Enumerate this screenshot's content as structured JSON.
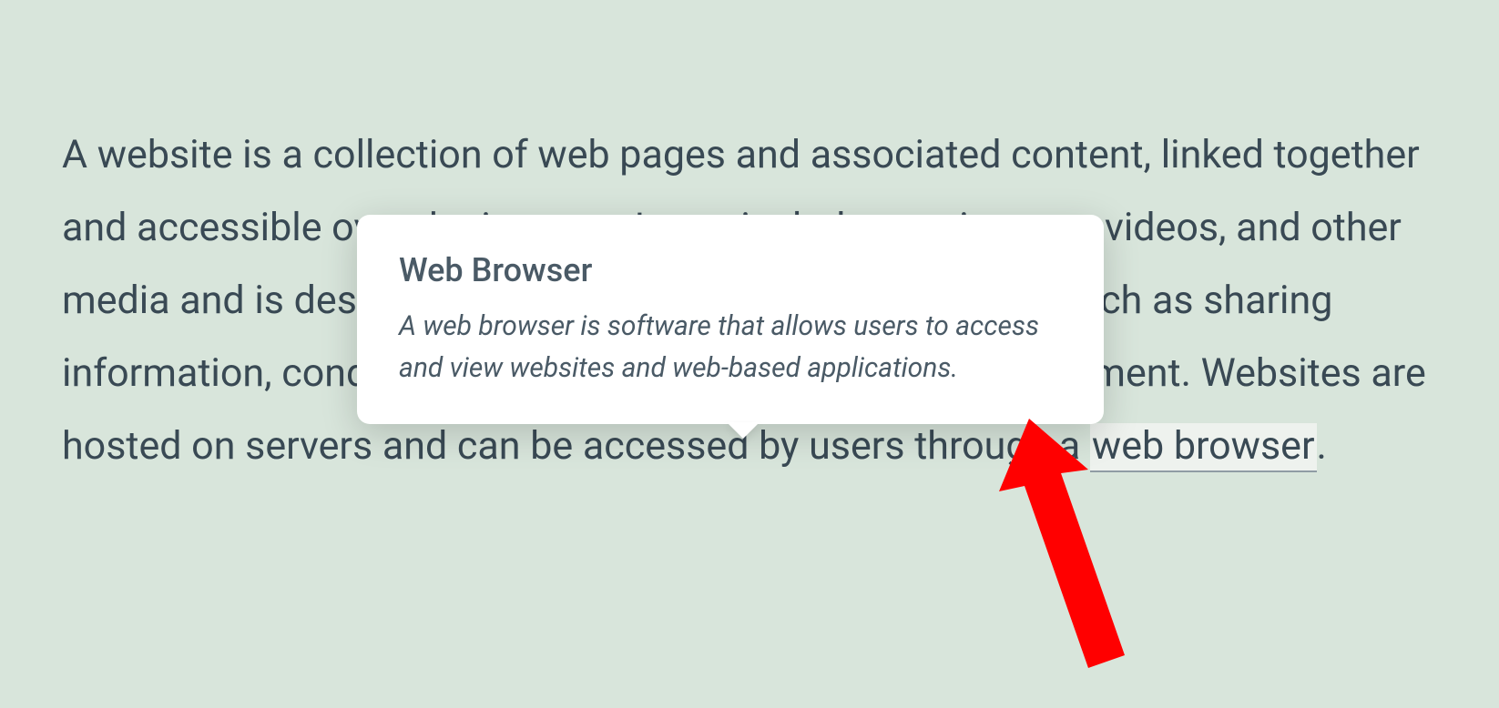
{
  "paragraph": {
    "part1": "A website is a collection of web pages and associated content, linked together and accessible over the internet. It can include text, images, videos, and other media and is designed to be viewed for various purposes such as sharing information, conducting transactions, or providing entertainment. Websites are hosted on servers and can be accessed by users through a ",
    "term": "web browser",
    "part2": "."
  },
  "popover": {
    "title": "Web Browser",
    "body": "A web browser is software that allows users to access and view websites and web-based applications."
  }
}
